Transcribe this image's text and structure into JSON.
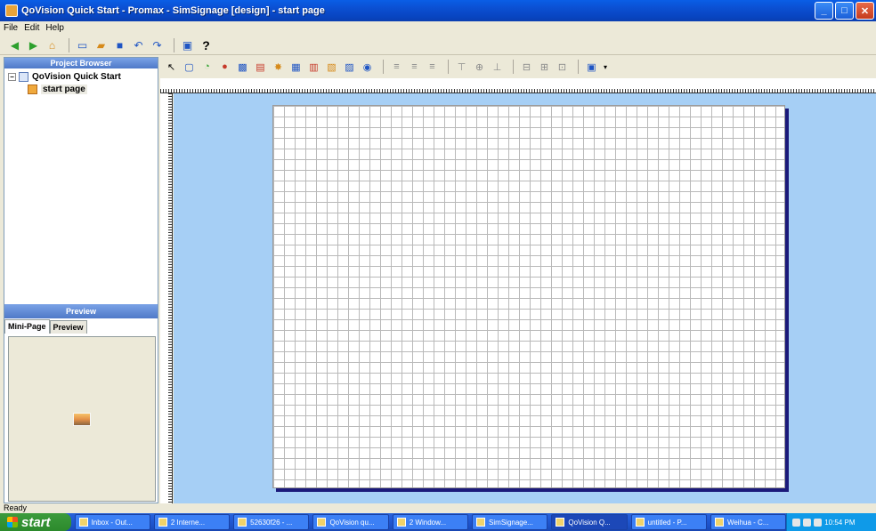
{
  "window": {
    "title": "QoVision Quick Start - Promax - SimSignage [design] - start page",
    "controls": [
      "_",
      "□",
      "✕"
    ]
  },
  "menu": [
    "File",
    "Edit",
    "Help"
  ],
  "toolbar_main": {
    "buttons": [
      "back-icon",
      "forward-icon",
      "home-icon",
      "new-icon",
      "open-icon",
      "save-icon",
      "undo-icon",
      "redo-icon",
      "monitor-icon",
      "help-icon"
    ],
    "help_label": "?"
  },
  "project_browser": {
    "header": "Project Browser",
    "root": "QoVision Quick Start",
    "expander": "−",
    "child": "start page"
  },
  "preview": {
    "header": "Preview",
    "tabs": [
      "Mini-Page",
      "Preview"
    ]
  },
  "status": {
    "text": "Ready"
  },
  "taskbar": {
    "start": "start",
    "tasks": [
      "Inbox - Out...",
      "2 Interne...",
      "52630f26 - ...",
      "QoVision qu...",
      "2 Window...",
      "SimSignage...",
      "QoVision Q...",
      "untitled - P...",
      "Weihua - C..."
    ],
    "clock": "10:54 PM"
  }
}
